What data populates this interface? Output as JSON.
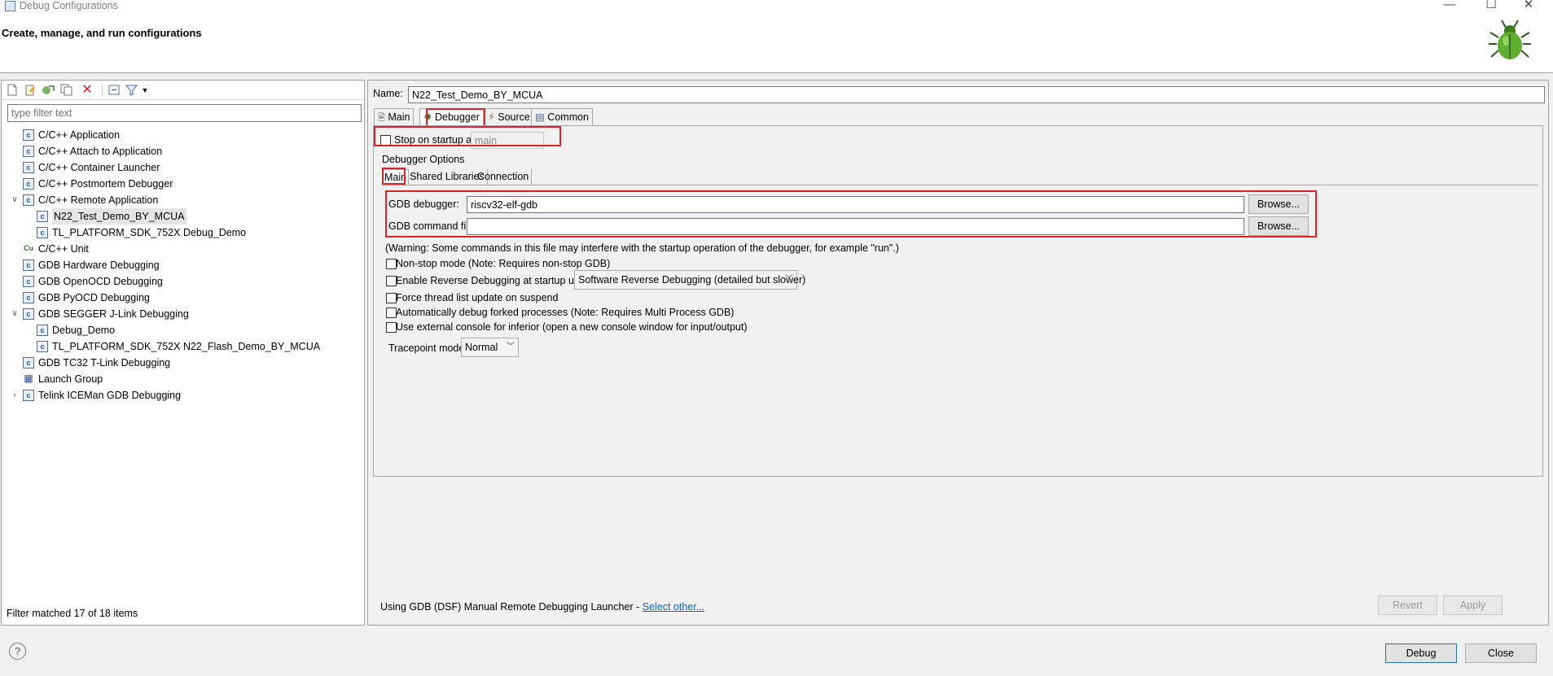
{
  "window": {
    "title": "Debug Configurations",
    "header_text": "Create, manage, and run configurations",
    "min_glyph": "—",
    "max_glyph": "☐",
    "close_glyph": "✕"
  },
  "left": {
    "filter_placeholder": "type filter text",
    "tree": [
      {
        "label": "C/C++ Application",
        "level": 0,
        "expand": "",
        "icon": "c-icon"
      },
      {
        "label": "C/C++ Attach to Application",
        "level": 0,
        "expand": "",
        "icon": "c-icon"
      },
      {
        "label": "C/C++ Container Launcher",
        "level": 0,
        "expand": "",
        "icon": "c-icon"
      },
      {
        "label": "C/C++ Postmortem Debugger",
        "level": 0,
        "expand": "",
        "icon": "c-icon"
      },
      {
        "label": "C/C++ Remote Application",
        "level": 0,
        "expand": "v",
        "icon": "c-icon"
      },
      {
        "label": "N22_Test_Demo_BY_MCUA",
        "level": 1,
        "expand": "",
        "icon": "c-icon",
        "selected": true
      },
      {
        "label": "TL_PLATFORM_SDK_752X Debug_Demo",
        "level": 1,
        "expand": "",
        "icon": "c-icon"
      },
      {
        "label": "C/C++ Unit",
        "level": 0,
        "expand": "",
        "icon": "cu-icon"
      },
      {
        "label": "GDB Hardware Debugging",
        "level": 0,
        "expand": "",
        "icon": "c-icon"
      },
      {
        "label": "GDB OpenOCD Debugging",
        "level": 0,
        "expand": "",
        "icon": "c-icon"
      },
      {
        "label": "GDB PyOCD Debugging",
        "level": 0,
        "expand": "",
        "icon": "c-icon"
      },
      {
        "label": "GDB SEGGER J-Link Debugging",
        "level": 0,
        "expand": "v",
        "icon": "c-icon"
      },
      {
        "label": "Debug_Demo",
        "level": 1,
        "expand": "",
        "icon": "c-icon"
      },
      {
        "label": "TL_PLATFORM_SDK_752X N22_Flash_Demo_BY_MCUA",
        "level": 1,
        "expand": "",
        "icon": "c-icon"
      },
      {
        "label": "GDB TC32 T-Link Debugging",
        "level": 0,
        "expand": "",
        "icon": "c-icon"
      },
      {
        "label": "Launch Group",
        "level": 0,
        "expand": "",
        "icon": "launch-group-icon"
      },
      {
        "label": "Telink ICEMan GDB Debugging",
        "level": 0,
        "expand": ">",
        "icon": "c-icon"
      }
    ],
    "status": "Filter matched 17 of 18 items"
  },
  "right": {
    "name_label": "Name:",
    "name_value": "N22_Test_Demo_BY_MCUA",
    "tabs": [
      "Main",
      "Debugger",
      "Source",
      "Common"
    ],
    "stop_on_startup_label": "Stop on startup at:",
    "stop_on_startup_value": "main",
    "debugger_options_label": "Debugger Options",
    "subtabs": [
      "Main",
      "Shared Libraries",
      "Connection"
    ],
    "gdb_debugger_label": "GDB debugger:",
    "gdb_debugger_value": "riscv32-elf-gdb",
    "gdb_command_file_label": "GDB command file:",
    "gdb_command_file_value": "",
    "browse_label": "Browse...",
    "warning": "(Warning: Some commands in this file may interfere with the startup operation of the debugger, for example \"run\".)",
    "non_stop": "Non-stop mode (Note: Requires non-stop GDB)",
    "reverse": "Enable Reverse Debugging at startup using:",
    "reverse_option": "Software Reverse Debugging (detailed but slower)",
    "force_thread": "Force thread list update on suspend",
    "auto_fork": "Automatically debug forked processes (Note: Requires Multi Process GDB)",
    "external_console": "Use external console for inferior (open a new console window for input/output)",
    "tracepoint_label": "Tracepoint mode:",
    "tracepoint_value": "Normal",
    "launcher_text": "Using GDB (DSF) Manual Remote Debugging Launcher - ",
    "select_other": "Select other...",
    "revert": "Revert",
    "apply": "Apply"
  },
  "footer": {
    "help_glyph": "?",
    "debug": "Debug",
    "close": "Close"
  },
  "colors": {
    "highlight_box": "#e0202a",
    "link": "#0066cc"
  }
}
